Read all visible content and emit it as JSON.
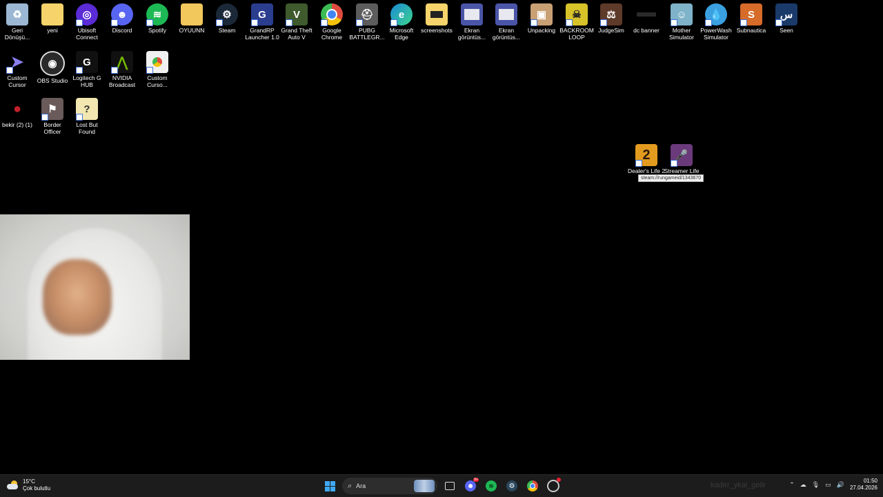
{
  "desktop_icons_row1": [
    {
      "label": "Geri\nDönüşü...",
      "icon": "recycle-bin-icon",
      "color": "#9bb7d3"
    },
    {
      "label": "yeni",
      "icon": "folder-icon",
      "color": "#f7d46b"
    },
    {
      "label": "Ubisoft\nConnect",
      "icon": "ubisoft-icon",
      "color": "#5a2bd6"
    },
    {
      "label": "Discord",
      "icon": "discord-icon",
      "color": "#5865f2"
    },
    {
      "label": "Spotify",
      "icon": "spotify-icon",
      "color": "#1db954"
    },
    {
      "label": "OYUUNN",
      "icon": "folder-icon",
      "color": "#f2c75c"
    },
    {
      "label": "Steam",
      "icon": "steam-icon",
      "color": "#1b2838"
    },
    {
      "label": "GrandRP\nLauncher 1.0",
      "icon": "grandrp-icon",
      "color": "#2a3d8f"
    },
    {
      "label": "Grand Theft\nAuto V",
      "icon": "gta-icon",
      "color": "#3f5a2c"
    },
    {
      "label": "Google\nChrome",
      "icon": "chrome-icon",
      "color": "#e04b3f"
    },
    {
      "label": "PUBG\nBATTLEGR...",
      "icon": "pubg-icon",
      "color": "#5c5c5c"
    },
    {
      "label": "Microsoft\nEdge",
      "icon": "edge-icon",
      "color": "#1b8ad6"
    },
    {
      "label": "screenshots",
      "icon": "folder-icon",
      "color": "#f7d46b"
    },
    {
      "label": "Ekran\ngörüntüs...",
      "icon": "image-icon",
      "color": "#4a55a8"
    },
    {
      "label": "Ekran\ngörüntüs...",
      "icon": "image-icon",
      "color": "#4a55a8"
    },
    {
      "label": "Unpacking",
      "icon": "box-icon",
      "color": "#c8a074"
    },
    {
      "label": "BACKROOM\nLOOP",
      "icon": "backroom-icon",
      "color": "#d8c22a"
    },
    {
      "label": "JudgeSim",
      "icon": "gavel-icon",
      "color": "#5e3a2a"
    },
    {
      "label": "dc banner",
      "icon": "image-icon",
      "color": "#2a2a2a"
    },
    {
      "label": "Mother\nSimulator",
      "icon": "mother-sim-icon",
      "color": "#7fb3c9"
    },
    {
      "label": "PowerWash\nSimulator",
      "icon": "powerwash-icon",
      "color": "#3aa0e0"
    },
    {
      "label": "Subnautica",
      "icon": "subnautica-icon",
      "color": "#d66b2a"
    },
    {
      "label": "Seen",
      "icon": "seen-icon",
      "color": "#1a3a6a"
    }
  ],
  "desktop_icons_row2": [
    {
      "label": "Custom\nCursor",
      "icon": "cursor-icon",
      "color": "#5a4fd8"
    },
    {
      "label": "OBS Studio",
      "icon": "obs-icon",
      "color": "#2a2a2a"
    },
    {
      "label": "Logitech G\nHUB",
      "icon": "logitech-icon",
      "color": "#111111"
    },
    {
      "label": "NVIDIA\nBroadcast",
      "icon": "nvidia-icon",
      "color": "#76b900"
    },
    {
      "label": "Custom\nCurso...",
      "icon": "chrome-file-icon",
      "color": "#f1f1f1"
    }
  ],
  "desktop_icons_row3": [
    {
      "label": "bekir (2) (1)",
      "icon": "image-icon",
      "color": "#c0202a"
    },
    {
      "label": "Border\nOfficer",
      "icon": "border-officer-icon",
      "color": "#6a5a5a"
    },
    {
      "label": "Lost But\nFound",
      "icon": "lost-found-icon",
      "color": "#f2e7b0"
    }
  ],
  "desktop_icons_floating": [
    {
      "label": "Dealer's Life 2",
      "icon": "dealers-life-icon",
      "color": "#e39b1f"
    },
    {
      "label": "Streamer Life",
      "icon": "streamer-life-icon",
      "color": "#6a3a7a"
    }
  ],
  "tooltip": "steam://rungameid/1343670",
  "taskbar": {
    "weather_temp": "15°C",
    "weather_desc": "Çok bulutlu",
    "search_placeholder": "Ara",
    "discord_badge": "9+",
    "ghost_text": "kadirr_ykal_gelir",
    "time": "01:50",
    "date": "27.04.2026"
  }
}
